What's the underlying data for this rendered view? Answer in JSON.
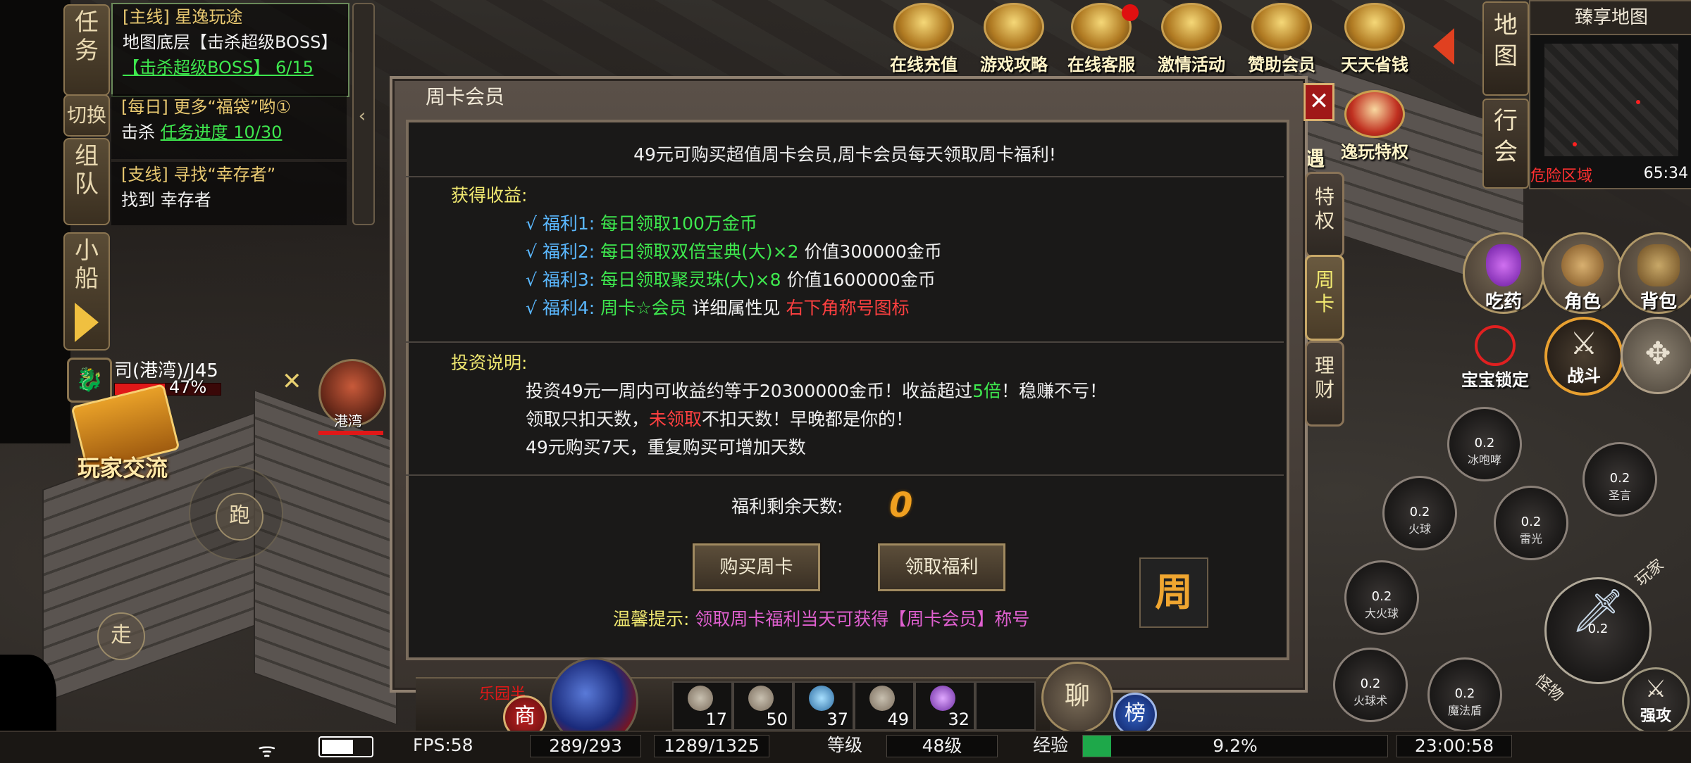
{
  "quest_panel": {
    "tabs": [
      "任务",
      "切换",
      "组队",
      "小船"
    ],
    "quests": [
      {
        "title": "[主线] 星逸玩途",
        "line1": "地图底层【击杀超级BOSS】",
        "line2": "【击杀超级BOSS】 6/15"
      },
      {
        "title": "[每日] 更多“福袋”哟①",
        "line1_prefix": "击杀 ",
        "line1_link": "任务进度 10/30"
      },
      {
        "title": "[支线] 寻找“幸存者”",
        "line1": "找到 幸存者"
      }
    ]
  },
  "player": {
    "name_line": "司(港湾)/J45",
    "hp_percent_label": "47%",
    "hp_fraction": 0.47,
    "avatar_name": "港湾",
    "chat_label": "玩家交流",
    "run_label": "跑",
    "walk_label": "走"
  },
  "top_icons": [
    "在线充值",
    "游戏攻略",
    "在线客服",
    "激情活动",
    "赞助会员",
    "天天省钱",
    "逸玩特权"
  ],
  "top_icon_partial": "遇",
  "minimap": {
    "title": "臻享地图",
    "btn_map": "地图",
    "btn_walk": "行会",
    "danger_label": "危险区域",
    "time": "65:34"
  },
  "dialog": {
    "title": "周卡会员",
    "headline": "49元可购买超值周卡会员,周卡会员每天领取周卡福利!",
    "benefits_header": "获得收益:",
    "benefits": [
      {
        "label": "√ 福利1:",
        "green": "每日领取100万金币",
        "white": "",
        "red": ""
      },
      {
        "label": "√ 福利2:",
        "green": "每日领取双倍宝典(大)×2",
        "white": " 价值300000金币",
        "red": ""
      },
      {
        "label": "√ 福利3:",
        "green": "每日领取聚灵珠(大)×8",
        "white": " 价值1600000金币",
        "red": ""
      },
      {
        "label": "√ 福利4:",
        "green": "周卡☆会员",
        "white": " 详细属性见 ",
        "red": "右下角称号图标"
      }
    ],
    "invest_header": "投资说明:",
    "invest_line1_a": "投资49元一周内可收益约等于20300000金币！收益超过",
    "invest_line1_b": "5倍",
    "invest_line1_c": "！稳赚不亏！",
    "invest_line2_a": "领取只扣天数，",
    "invest_line2_b": "未领取",
    "invest_line2_c": "不扣天数！早晚都是你的！",
    "invest_line3": "49元购买7天，重复购买可增加天数",
    "remaining_label": "福利剩余天数:",
    "remaining_value": "0",
    "buy_button": "购买周卡",
    "claim_button": "领取福利",
    "tip_label": "温馨提示:",
    "tip_text": "领取周卡福利当天可获得【周卡会员】称号",
    "badge": "周",
    "side_tabs": [
      "特权",
      "周卡",
      "理财"
    ],
    "close": "✕"
  },
  "right_buttons": [
    "吃药",
    "角色",
    "背包",
    "宝宝锁定",
    "战斗"
  ],
  "skills": [
    {
      "cd": "0.2",
      "name": "冰咆哮"
    },
    {
      "cd": "0.2",
      "name": "圣言"
    },
    {
      "cd": "0.2",
      "name": "火球"
    },
    {
      "cd": "0.2",
      "name": "雷光"
    },
    {
      "cd": "0.2",
      "name": "大火球"
    },
    {
      "cd": "0.2",
      "name": ""
    },
    {
      "cd": "0.2",
      "name": "火球术"
    },
    {
      "cd": "0.2",
      "name": "魔法盾"
    }
  ],
  "skill_side_labels": [
    "玩家",
    "怪物",
    "强攻"
  ],
  "belt": {
    "shop_label": "商",
    "chat_label": "聊",
    "rank_label": "榜",
    "slots": [
      {
        "count": "17"
      },
      {
        "count": "50"
      },
      {
        "count": "37"
      },
      {
        "count": "49"
      },
      {
        "count": "32"
      }
    ],
    "scroll_text": "乐园半"
  },
  "status_bar": {
    "fps": "FPS:58",
    "hp": "289/293",
    "mp": "1289/1325",
    "level_label": "等级",
    "level_value": "48级",
    "exp_label": "经验",
    "exp_percent": "9.2%",
    "exp_fraction": 0.092,
    "clock": "23:00:58"
  },
  "colors": {
    "accent_green": "#3ee84e",
    "accent_red": "#ff4040",
    "gold": "#e8c870",
    "blue": "#5ab8ff",
    "pink": "#e060d0"
  }
}
